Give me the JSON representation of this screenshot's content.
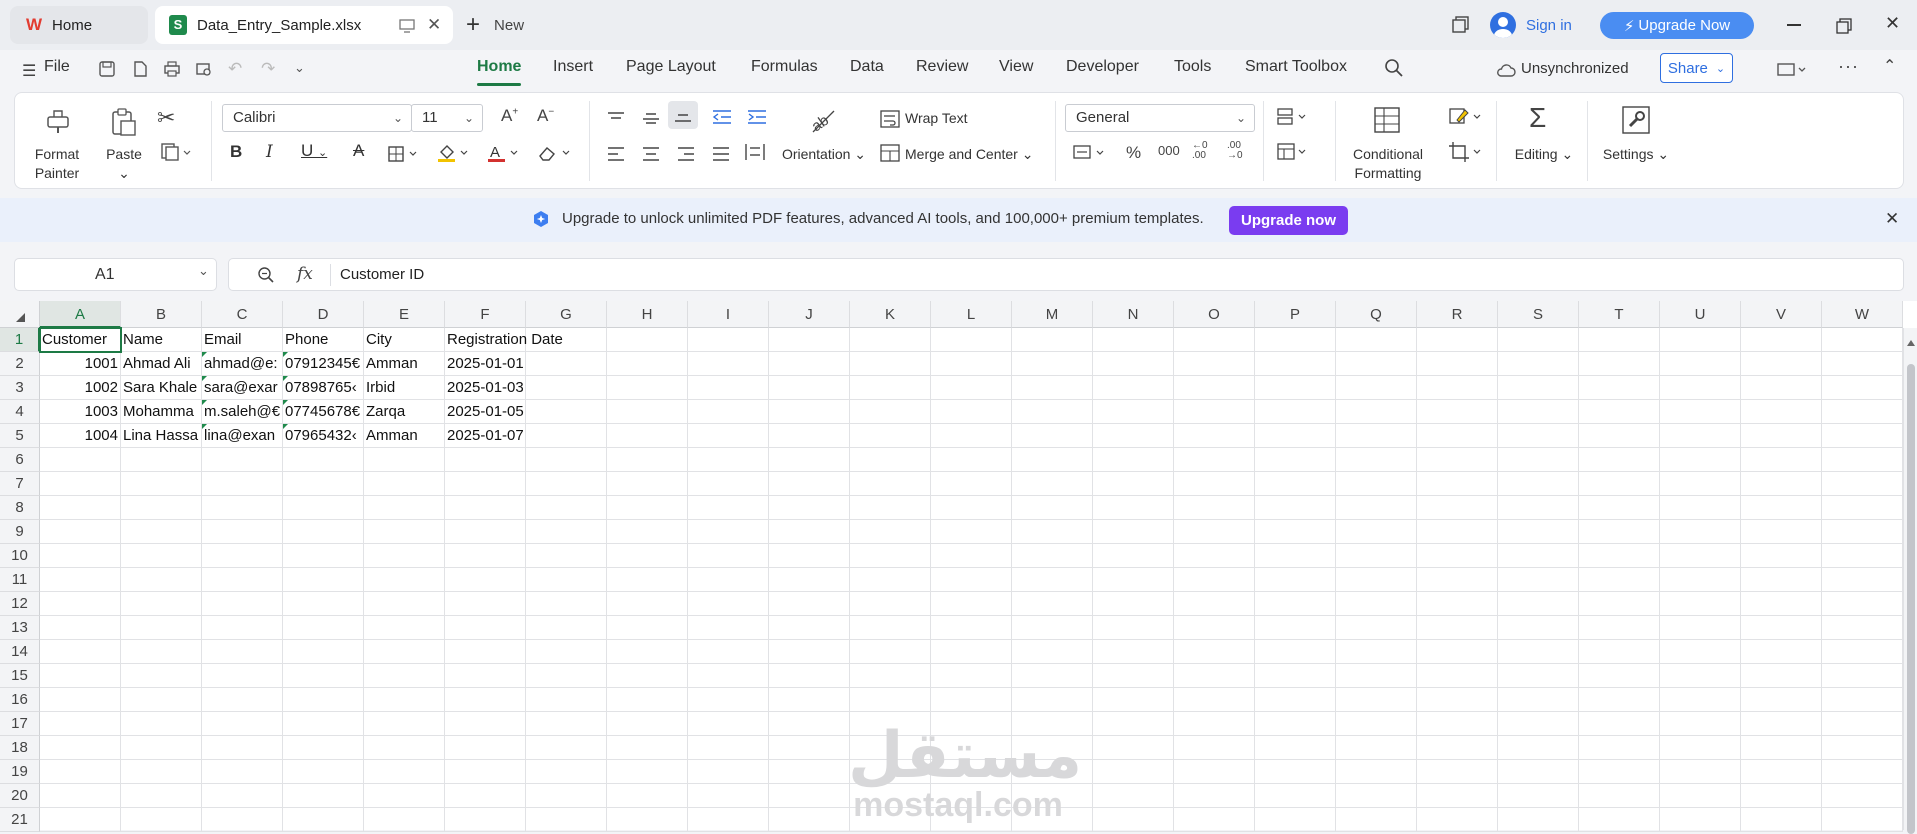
{
  "tabs": {
    "home_label": "Home",
    "file_label": "Data_Entry_Sample.xlsx",
    "new_label": "New"
  },
  "account": {
    "signin_label": "Sign in",
    "upgrade_label": "Upgrade Now"
  },
  "menu": {
    "file_label": "File",
    "items": [
      "Home",
      "Insert",
      "Page Layout",
      "Formulas",
      "Data",
      "Review",
      "View",
      "Developer",
      "Tools",
      "Smart Toolbox"
    ],
    "sync_label": "Unsynchronized",
    "share_label": "Share"
  },
  "ribbon": {
    "format_painter": "Format\nPainter",
    "paste": "Paste",
    "font_name": "Calibri",
    "font_size": "11",
    "wrap_text": "Wrap Text",
    "orientation": "Orientation",
    "merge_center": "Merge and Center",
    "number_format": "General",
    "conditional_formatting": "Conditional\nFormatting",
    "editing": "Editing",
    "settings": "Settings"
  },
  "banner": {
    "message": "Upgrade to unlock unlimited PDF features, advanced AI tools, and 100,000+ premium templates.",
    "button": "Upgrade now"
  },
  "formula_bar": {
    "cell_ref": "A1",
    "fx": "fx",
    "value": "Customer ID"
  },
  "sheet": {
    "columns": [
      "A",
      "B",
      "C",
      "D",
      "E",
      "F",
      "G",
      "H",
      "I",
      "J",
      "K",
      "L",
      "M",
      "N",
      "O",
      "P",
      "Q",
      "R",
      "S",
      "T",
      "U",
      "V",
      "W"
    ],
    "rows": [
      "1",
      "2",
      "3",
      "4",
      "5",
      "6",
      "7",
      "8",
      "9",
      "10",
      "11",
      "12",
      "13",
      "14",
      "15",
      "16",
      "17",
      "18",
      "19",
      "20",
      "21"
    ],
    "header_row": [
      "Customer",
      "Name",
      "Email",
      "Phone",
      "City",
      "Registration Date"
    ],
    "data": [
      [
        "1001",
        "Ahmad Ali",
        "ahmad@e:",
        "07912345€",
        "Amman",
        "2025-01-01"
      ],
      [
        "1002",
        "Sara Khale",
        "sara@exar",
        "07898765‹",
        "Irbid",
        "2025-01-03"
      ],
      [
        "1003",
        "Mohamma",
        "m.saleh@€",
        "07745678€",
        "Zarqa",
        "2025-01-05"
      ],
      [
        "1004",
        "Lina Hassa",
        "lina@exan",
        "07965432‹",
        "Amman",
        "2025-01-07"
      ]
    ]
  },
  "watermark": {
    "arabic": "مستقل",
    "latin": "mostaql.com"
  },
  "colors": {
    "accent": "#1d7a45",
    "brand_blue": "#2f6fe0",
    "upgrade_purple": "#7a3cf0"
  }
}
